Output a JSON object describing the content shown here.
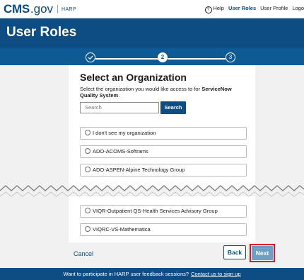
{
  "header": {
    "logo_main": "CMS",
    "logo_suffix": ".gov",
    "logo_app": "HARP",
    "nav": {
      "help_label": "Help",
      "user_roles_label": "User Roles",
      "user_profile_label": "User Profile",
      "logout_label": "Logo"
    }
  },
  "page_title": "User Roles",
  "steps": {
    "step2_label": "2",
    "step3_label": "3",
    "current_step": 2,
    "total_steps": 3
  },
  "form": {
    "heading": "Select an Organization",
    "subtitle_prefix": "Select the organization you would like access to for ",
    "subtitle_system": "ServiceNow Quality System",
    "subtitle_suffix": ".",
    "search_placeholder": "Search",
    "search_button": "Search",
    "options": [
      "I don't see my organization",
      "ADO-ACOMS-Softrams",
      "ADO-ASPEN-Alpine Technology Group",
      "VIQR-Outpatient QS-Health Services Advisory Group",
      "VIQRC-VS-Mathematica"
    ]
  },
  "actions": {
    "cancel_label": "Cancel",
    "back_label": "Back",
    "next_label": "Next"
  },
  "banner": {
    "text": "Want to participate in HARP user feedback sessions?",
    "link_text": "Contact us to sign up"
  },
  "colors": {
    "primary": "#0d4d83",
    "highlight_outline": "#e0122e",
    "next_disabled": "#6f9fc4"
  }
}
